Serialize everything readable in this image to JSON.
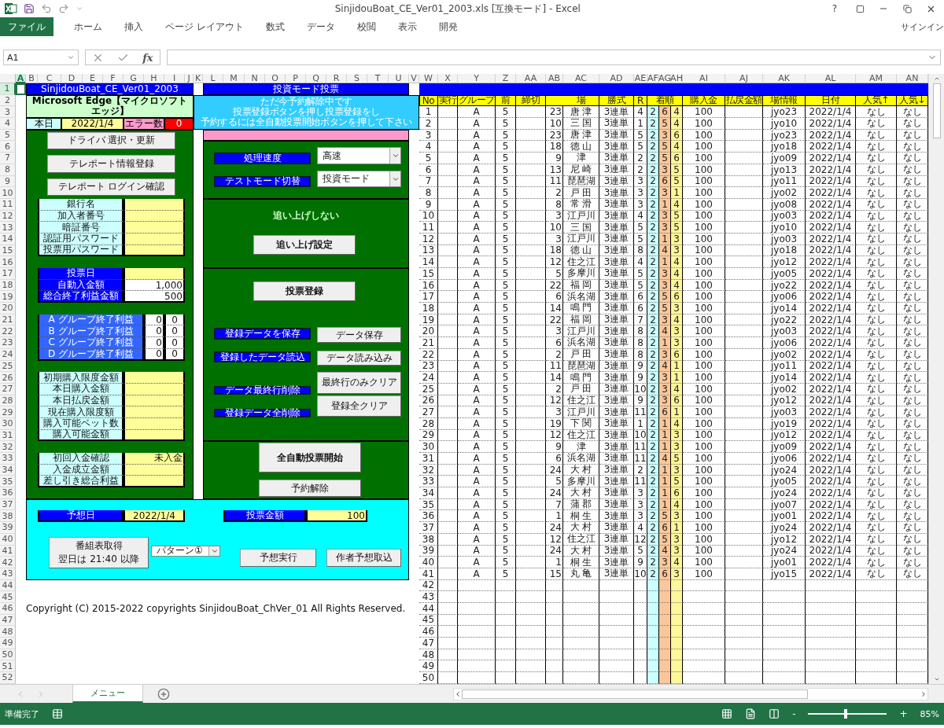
{
  "window": {
    "title": "SinjidouBoat_CE_Ver01_2003.xls  [互換モード] - Excel",
    "help": "?",
    "sign_in": "サインイン"
  },
  "ribbon_tabs": [
    {
      "label": "ファイル",
      "selected": true
    },
    {
      "label": "ホーム",
      "selected": false
    },
    {
      "label": "挿入",
      "selected": false
    },
    {
      "label": "ページ レイアウト",
      "selected": false
    },
    {
      "label": "数式",
      "selected": false
    },
    {
      "label": "データ",
      "selected": false
    },
    {
      "label": "校閲",
      "selected": false
    },
    {
      "label": "表示",
      "selected": false
    },
    {
      "label": "開発",
      "selected": false
    }
  ],
  "formula_bar": {
    "name_box": "A1",
    "fx": "fx"
  },
  "column_headers": [
    {
      "label": "A",
      "selected": true
    },
    {
      "label": "B",
      "selected": false
    },
    {
      "label": "C",
      "selected": false
    },
    {
      "label": "D",
      "selected": false
    },
    {
      "label": "E",
      "selected": false
    },
    {
      "label": "F",
      "selected": false
    },
    {
      "label": "G",
      "selected": false
    },
    {
      "label": "H",
      "selected": false
    },
    {
      "label": "I",
      "selected": false
    },
    {
      "label": "J",
      "selected": false
    },
    {
      "label": "K",
      "selected": false
    },
    {
      "label": "L",
      "selected": false
    },
    {
      "label": "M",
      "selected": false
    },
    {
      "label": "N",
      "selected": false
    },
    {
      "label": "O",
      "selected": false
    },
    {
      "label": "P",
      "selected": false
    },
    {
      "label": "Q",
      "selected": false
    },
    {
      "label": "R",
      "selected": false
    },
    {
      "label": "S",
      "selected": false
    },
    {
      "label": "T",
      "selected": false
    },
    {
      "label": "U",
      "selected": false
    },
    {
      "label": "V",
      "selected": false
    },
    {
      "label": "W",
      "selected": false
    },
    {
      "label": "X",
      "selected": false
    },
    {
      "label": "Y",
      "selected": false
    },
    {
      "label": "Z",
      "selected": false
    },
    {
      "label": "AA",
      "selected": false
    },
    {
      "label": "AB",
      "selected": false
    },
    {
      "label": "AC",
      "selected": false
    },
    {
      "label": "AD",
      "selected": false
    },
    {
      "label": "AE",
      "selected": false
    },
    {
      "label": "AF",
      "selected": false
    },
    {
      "label": "AG",
      "selected": false
    },
    {
      "label": "AH",
      "selected": false
    },
    {
      "label": "AI",
      "selected": false
    },
    {
      "label": "AJ",
      "selected": false
    },
    {
      "label": "AK",
      "selected": false
    },
    {
      "label": "AL",
      "selected": false
    },
    {
      "label": "AM",
      "selected": false
    },
    {
      "label": "AN",
      "selected": false
    }
  ],
  "row_headers": [
    {
      "label": "1",
      "selected": true
    },
    {
      "label": "2",
      "selected": false
    },
    {
      "label": "3",
      "selected": false
    },
    {
      "label": "4",
      "selected": false
    },
    {
      "label": "5",
      "selected": false
    },
    {
      "label": "6",
      "selected": false
    },
    {
      "label": "7",
      "selected": false
    },
    {
      "label": "8",
      "selected": false
    },
    {
      "label": "9",
      "selected": false
    },
    {
      "label": "10",
      "selected": false
    },
    {
      "label": "11",
      "selected": false
    },
    {
      "label": "12",
      "selected": false
    },
    {
      "label": "13",
      "selected": false
    },
    {
      "label": "14",
      "selected": false
    },
    {
      "label": "15",
      "selected": false
    },
    {
      "label": "16",
      "selected": false
    },
    {
      "label": "17",
      "selected": false
    },
    {
      "label": "18",
      "selected": false
    },
    {
      "label": "19",
      "selected": false
    },
    {
      "label": "20",
      "selected": false
    },
    {
      "label": "21",
      "selected": false
    },
    {
      "label": "22",
      "selected": false
    },
    {
      "label": "23",
      "selected": false
    },
    {
      "label": "24",
      "selected": false
    },
    {
      "label": "25",
      "selected": false
    },
    {
      "label": "26",
      "selected": false
    },
    {
      "label": "27",
      "selected": false
    },
    {
      "label": "28",
      "selected": false
    },
    {
      "label": "29",
      "selected": false
    },
    {
      "label": "30",
      "selected": false
    },
    {
      "label": "31",
      "selected": false
    },
    {
      "label": "32",
      "selected": false
    },
    {
      "label": "33",
      "selected": false
    },
    {
      "label": "34",
      "selected": false
    },
    {
      "label": "35",
      "selected": false
    },
    {
      "label": "36",
      "selected": false
    },
    {
      "label": "37",
      "selected": false
    },
    {
      "label": "38",
      "selected": false
    },
    {
      "label": "39",
      "selected": false
    },
    {
      "label": "40",
      "selected": false
    },
    {
      "label": "41",
      "selected": false
    },
    {
      "label": "42",
      "selected": false
    },
    {
      "label": "43",
      "selected": false
    },
    {
      "label": "44",
      "selected": false
    },
    {
      "label": "45",
      "selected": false
    },
    {
      "label": "46",
      "selected": false
    },
    {
      "label": "47",
      "selected": false
    },
    {
      "label": "48",
      "selected": false
    },
    {
      "label": "49",
      "selected": false
    },
    {
      "label": "50",
      "selected": false
    },
    {
      "label": "51",
      "selected": false
    },
    {
      "label": "52",
      "selected": false
    }
  ],
  "left_panel": {
    "title": "SinjidouBoat_CE_Ver01_2003",
    "browser": "Microsoft Edge【マイクロソフトエッジ】",
    "today_label": "本日",
    "today": "2022/1/4",
    "error_label": "エラー数",
    "errors": "0",
    "buttons": [
      "ドライバ 選択・更新",
      "テレポート情報登録",
      "テレポート ログイン確認"
    ],
    "account_fields": [
      "銀行名",
      "加入者番号",
      "暗証番号",
      "認証用パスワード",
      "投票用パスワード"
    ],
    "settings": [
      {
        "label": "投票日"
      },
      {
        "label": "自動入金額",
        "value": "1,000"
      },
      {
        "label": "総合終了利益金額",
        "value": "500"
      }
    ],
    "group_profits": [
      {
        "label": "A グループ終了利益",
        "value": "0",
        "value_2": "0"
      },
      {
        "label": "B グループ終了利益",
        "value": "0",
        "value_2": "0"
      },
      {
        "label": "C グループ終了利益",
        "value": "0",
        "value_2": "0"
      },
      {
        "label": "D グループ終了利益",
        "value": "0",
        "value_2": "0"
      }
    ],
    "limits": [
      "初期購入限度金額",
      "本日購入金額",
      "本日払戻金額",
      "現在購入限度額",
      "購入可能ベット数",
      "購入可能金額"
    ],
    "deposit": [
      {
        "label": "初回入金確認",
        "value": "未入金"
      },
      {
        "label": "入金成立金額"
      },
      {
        "label": "差し引き総合利益"
      }
    ]
  },
  "middle_panel": {
    "title": "投資モード投票",
    "notice": [
      "ただ今予約解除中です",
      "投票登録ボタンを押し投票登録をし",
      "予約するには全自動投票開始ボタンを押して下さい"
    ],
    "speed_label": "処理速度",
    "speed": "高速",
    "mode_label": "テストモード切替",
    "mode": "投資モード",
    "chase_status": "追い上げしない",
    "chase_button": "追い上げ設定",
    "register_button": "投票登録",
    "actions": [
      {
        "label": "登録データを保存",
        "button": "データ保存"
      },
      {
        "label": "登録したデータ読込",
        "button": "データ読み込み"
      },
      {
        "label": "データ最終行削除",
        "button": "最終行のみクリア"
      },
      {
        "label": "登録データ全削除",
        "button": "登録全クリア"
      }
    ],
    "start_button": "全自動投票開始",
    "cancel_button": "予約解除"
  },
  "bottom_panel": {
    "date_label": "予想日",
    "date": "2022/1/4",
    "amount_label": "投票金額",
    "amount": "100",
    "schedule_button": "番組表取得",
    "schedule_note": "翌日は 21:40 以降",
    "pattern": "パターン①",
    "predict_button": "予想実行",
    "import_button": "作者予想取込"
  },
  "copyright": "Copyright (C) 2015-2022 copyrights SinjidouBoat_ChVer_01 All Rights Reserved.",
  "table": {
    "columns": [
      "No",
      "実行",
      "グループ",
      "前",
      "締切",
      "",
      "場",
      "勝式",
      "R",
      "",
      "着順",
      "",
      "購入金",
      "払戻金額",
      "場情報",
      "日付",
      "人気↑",
      "人気↓"
    ],
    "rows": [
      [
        "1",
        "",
        "A",
        "5",
        "",
        "23",
        "唐 津",
        "3連単",
        "4",
        "2",
        "6",
        "4",
        "100",
        "",
        "jyo23",
        "2022/1/4",
        "なし",
        "なし"
      ],
      [
        "2",
        "",
        "A",
        "5",
        "",
        "10",
        "三 国",
        "3連単",
        "1",
        "2",
        "5",
        "4",
        "100",
        "",
        "jyo10",
        "2022/1/4",
        "なし",
        "なし"
      ],
      [
        "3",
        "",
        "A",
        "5",
        "",
        "23",
        "唐 津",
        "3連単",
        "5",
        "2",
        "3",
        "6",
        "100",
        "",
        "jyo23",
        "2022/1/4",
        "なし",
        "なし"
      ],
      [
        "4",
        "",
        "A",
        "5",
        "",
        "18",
        "徳 山",
        "3連単",
        "5",
        "2",
        "5",
        "4",
        "100",
        "",
        "jyo18",
        "2022/1/4",
        "なし",
        "なし"
      ],
      [
        "5",
        "",
        "A",
        "5",
        "",
        "9",
        "津",
        "3連単",
        "2",
        "2",
        "5",
        "6",
        "100",
        "",
        "jyo09",
        "2022/1/4",
        "なし",
        "なし"
      ],
      [
        "6",
        "",
        "A",
        "5",
        "",
        "13",
        "尼 崎",
        "3連単",
        "2",
        "2",
        "3",
        "5",
        "100",
        "",
        "jyo13",
        "2022/1/4",
        "なし",
        "なし"
      ],
      [
        "7",
        "",
        "A",
        "5",
        "",
        "11",
        "琵琶湖",
        "3連単",
        "3",
        "2",
        "6",
        "5",
        "100",
        "",
        "jyo11",
        "2022/1/4",
        "なし",
        "なし"
      ],
      [
        "8",
        "",
        "A",
        "5",
        "",
        "2",
        "戸 田",
        "3連単",
        "3",
        "2",
        "3",
        "1",
        "100",
        "",
        "jyo02",
        "2022/1/4",
        "なし",
        "なし"
      ],
      [
        "9",
        "",
        "A",
        "5",
        "",
        "8",
        "常 滑",
        "3連単",
        "3",
        "2",
        "1",
        "4",
        "100",
        "",
        "jyo08",
        "2022/1/4",
        "なし",
        "なし"
      ],
      [
        "10",
        "",
        "A",
        "5",
        "",
        "3",
        "江戸川",
        "3連単",
        "4",
        "2",
        "3",
        "5",
        "100",
        "",
        "jyo03",
        "2022/1/4",
        "なし",
        "なし"
      ],
      [
        "11",
        "",
        "A",
        "5",
        "",
        "10",
        "三 国",
        "3連単",
        "5",
        "2",
        "3",
        "5",
        "100",
        "",
        "jyo10",
        "2022/1/4",
        "なし",
        "なし"
      ],
      [
        "12",
        "",
        "A",
        "5",
        "",
        "3",
        "江戸川",
        "3連単",
        "5",
        "2",
        "1",
        "3",
        "100",
        "",
        "jyo03",
        "2022/1/4",
        "なし",
        "なし"
      ],
      [
        "13",
        "",
        "A",
        "5",
        "",
        "18",
        "徳 山",
        "3連単",
        "8",
        "2",
        "4",
        "3",
        "100",
        "",
        "jyo18",
        "2022/1/4",
        "なし",
        "なし"
      ],
      [
        "14",
        "",
        "A",
        "5",
        "",
        "12",
        "住之江",
        "3連単",
        "4",
        "2",
        "1",
        "4",
        "100",
        "",
        "jyo12",
        "2022/1/4",
        "なし",
        "なし"
      ],
      [
        "15",
        "",
        "A",
        "5",
        "",
        "5",
        "多摩川",
        "3連単",
        "5",
        "2",
        "3",
        "4",
        "100",
        "",
        "jyo05",
        "2022/1/4",
        "なし",
        "なし"
      ],
      [
        "16",
        "",
        "A",
        "5",
        "",
        "22",
        "福 岡",
        "3連単",
        "5",
        "2",
        "3",
        "4",
        "100",
        "",
        "jyo22",
        "2022/1/4",
        "なし",
        "なし"
      ],
      [
        "17",
        "",
        "A",
        "5",
        "",
        "6",
        "浜名湖",
        "3連単",
        "6",
        "2",
        "5",
        "6",
        "100",
        "",
        "jyo06",
        "2022/1/4",
        "なし",
        "なし"
      ],
      [
        "18",
        "",
        "A",
        "5",
        "",
        "14",
        "鳴 門",
        "3連単",
        "6",
        "2",
        "5",
        "3",
        "100",
        "",
        "jyo14",
        "2022/1/4",
        "なし",
        "なし"
      ],
      [
        "19",
        "",
        "A",
        "5",
        "",
        "22",
        "福 岡",
        "3連単",
        "7",
        "2",
        "3",
        "4",
        "100",
        "",
        "jyo22",
        "2022/1/4",
        "なし",
        "なし"
      ],
      [
        "20",
        "",
        "A",
        "5",
        "",
        "3",
        "江戸川",
        "3連単",
        "8",
        "2",
        "4",
        "3",
        "100",
        "",
        "jyo03",
        "2022/1/4",
        "なし",
        "なし"
      ],
      [
        "21",
        "",
        "A",
        "5",
        "",
        "6",
        "浜名湖",
        "3連単",
        "8",
        "2",
        "1",
        "3",
        "100",
        "",
        "jyo06",
        "2022/1/4",
        "なし",
        "なし"
      ],
      [
        "22",
        "",
        "A",
        "5",
        "",
        "2",
        "戸 田",
        "3連単",
        "8",
        "2",
        "3",
        "6",
        "100",
        "",
        "jyo02",
        "2022/1/4",
        "なし",
        "なし"
      ],
      [
        "23",
        "",
        "A",
        "5",
        "",
        "11",
        "琵琶湖",
        "3連単",
        "9",
        "2",
        "4",
        "1",
        "100",
        "",
        "jyo11",
        "2022/1/4",
        "なし",
        "なし"
      ],
      [
        "24",
        "",
        "A",
        "5",
        "",
        "14",
        "鳴 門",
        "3連単",
        "9",
        "2",
        "3",
        "1",
        "100",
        "",
        "jyo14",
        "2022/1/4",
        "なし",
        "なし"
      ],
      [
        "25",
        "",
        "A",
        "5",
        "",
        "2",
        "戸 田",
        "3連単",
        "10",
        "2",
        "3",
        "4",
        "100",
        "",
        "jyo02",
        "2022/1/4",
        "なし",
        "なし"
      ],
      [
        "26",
        "",
        "A",
        "5",
        "",
        "12",
        "住之江",
        "3連単",
        "9",
        "2",
        "3",
        "6",
        "100",
        "",
        "jyo12",
        "2022/1/4",
        "なし",
        "なし"
      ],
      [
        "27",
        "",
        "A",
        "5",
        "",
        "3",
        "江戸川",
        "3連単",
        "11",
        "2",
        "6",
        "1",
        "100",
        "",
        "jyo03",
        "2022/1/4",
        "なし",
        "なし"
      ],
      [
        "28",
        "",
        "A",
        "5",
        "",
        "19",
        "下 関",
        "3連単",
        "1",
        "2",
        "1",
        "4",
        "100",
        "",
        "jyo19",
        "2022/1/4",
        "なし",
        "なし"
      ],
      [
        "29",
        "",
        "A",
        "5",
        "",
        "12",
        "住之江",
        "3連単",
        "10",
        "2",
        "1",
        "3",
        "100",
        "",
        "jyo12",
        "2022/1/4",
        "なし",
        "なし"
      ],
      [
        "30",
        "",
        "A",
        "5",
        "",
        "9",
        "津",
        "3連単",
        "11",
        "2",
        "1",
        "3",
        "100",
        "",
        "jyo09",
        "2022/1/4",
        "なし",
        "なし"
      ],
      [
        "31",
        "",
        "A",
        "5",
        "",
        "6",
        "浜名湖",
        "3連単",
        "11",
        "2",
        "4",
        "5",
        "100",
        "",
        "jyo06",
        "2022/1/4",
        "なし",
        "なし"
      ],
      [
        "32",
        "",
        "A",
        "5",
        "",
        "24",
        "大 村",
        "3連単",
        "2",
        "2",
        "1",
        "3",
        "100",
        "",
        "jyo24",
        "2022/1/4",
        "なし",
        "なし"
      ],
      [
        "33",
        "",
        "A",
        "5",
        "",
        "5",
        "多摩川",
        "3連単",
        "11",
        "2",
        "1",
        "5",
        "100",
        "",
        "jyo05",
        "2022/1/4",
        "なし",
        "なし"
      ],
      [
        "34",
        "",
        "A",
        "5",
        "",
        "24",
        "大 村",
        "3連単",
        "3",
        "2",
        "1",
        "6",
        "100",
        "",
        "jyo24",
        "2022/1/4",
        "なし",
        "なし"
      ],
      [
        "35",
        "",
        "A",
        "5",
        "",
        "7",
        "蒲 郡",
        "3連単",
        "3",
        "2",
        "1",
        "4",
        "100",
        "",
        "jyo07",
        "2022/1/4",
        "なし",
        "なし"
      ],
      [
        "36",
        "",
        "A",
        "5",
        "",
        "1",
        "桐 生",
        "3連単",
        "3",
        "2",
        "5",
        "3",
        "100",
        "",
        "jyo01",
        "2022/1/4",
        "なし",
        "なし"
      ],
      [
        "37",
        "",
        "A",
        "5",
        "",
        "24",
        "大 村",
        "3連単",
        "4",
        "2",
        "6",
        "1",
        "100",
        "",
        "jyo24",
        "2022/1/4",
        "なし",
        "なし"
      ],
      [
        "38",
        "",
        "A",
        "5",
        "",
        "12",
        "住之江",
        "3連単",
        "12",
        "2",
        "5",
        "3",
        "100",
        "",
        "jyo12",
        "2022/1/4",
        "なし",
        "なし"
      ],
      [
        "39",
        "",
        "A",
        "5",
        "",
        "24",
        "大 村",
        "3連単",
        "5",
        "2",
        "4",
        "3",
        "100",
        "",
        "jyo24",
        "2022/1/4",
        "なし",
        "なし"
      ],
      [
        "40",
        "",
        "A",
        "5",
        "",
        "1",
        "桐 生",
        "3連単",
        "9",
        "2",
        "3",
        "4",
        "100",
        "",
        "jyo01",
        "2022/1/4",
        "なし",
        "なし"
      ],
      [
        "41",
        "",
        "A",
        "5",
        "",
        "15",
        "丸 亀",
        "3連単",
        "10",
        "2",
        "6",
        "3",
        "100",
        "",
        "jyo15",
        "2022/1/4",
        "なし",
        "なし"
      ],
      [
        "42"
      ],
      [
        "43"
      ],
      [
        "44"
      ],
      [
        "45"
      ],
      [
        "46"
      ],
      [
        "47"
      ],
      [
        "48"
      ],
      [
        "49"
      ],
      [
        "50"
      ]
    ]
  },
  "sheet_tabs": [
    {
      "label": "メニュー",
      "selected": true
    }
  ],
  "status_bar": {
    "status": "準備完了",
    "zoom_out": "-",
    "zoom_in": "+",
    "level": 0.46,
    "zoom": "85%"
  }
}
